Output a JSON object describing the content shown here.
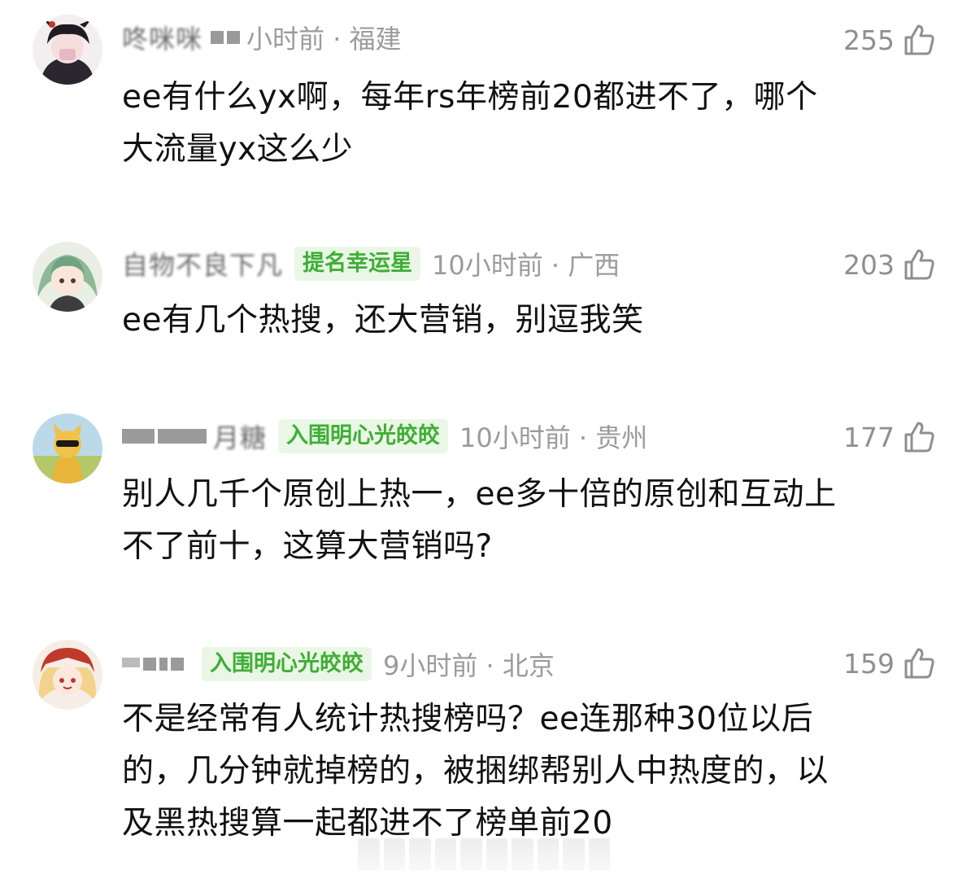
{
  "comments": [
    {
      "username": "咚咪咪",
      "badge": "",
      "time_location": "小时前 · 福建",
      "likes": "255",
      "text": "ee有什么yx啊，每年rs年榜前20都进不了，哪个\n大流量yx这么少"
    },
    {
      "username": "自物不良下凡",
      "badge": "提名幸运星",
      "time_location": "10小时前 · 广西",
      "likes": "203",
      "text": "ee有几个热搜，还大营销，别逗我笑"
    },
    {
      "username": "月糖",
      "badge": "入围明心光皎皎",
      "time_location": "10小时前 · 贵州",
      "likes": "177",
      "text": "别人几千个原创上热一，ee多十倍的原创和互动上\n不了前十，这算大营销吗?"
    },
    {
      "username": "",
      "badge": "入围明心光皎皎",
      "time_location": "9小时前 · 北京",
      "likes": "159",
      "text": "不是经常有人统计热搜榜吗？ee连那种30位以后\n的，几分钟就掉榜的，被捆绑帮别人中热度的，以\n及黑热搜算一起都进不了榜单前20"
    }
  ],
  "colors": {
    "badge_text": "#3fae35",
    "badge_bg": "#eaf7e6",
    "meta": "#9b9b9b",
    "body": "#111111"
  },
  "icons": {
    "like": "thumbs-up-icon"
  }
}
